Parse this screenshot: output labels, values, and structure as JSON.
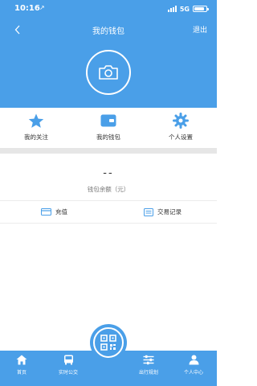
{
  "status_bar": {
    "time": "10:16",
    "location_glyph": "↗",
    "network": "5G",
    "battery_level": 0.85
  },
  "nav": {
    "back_icon": "chevron-left-icon",
    "title": "我的钱包",
    "logout": "退出"
  },
  "profile": {
    "avatar_icon": "camera-icon"
  },
  "menu": {
    "items": [
      {
        "label": "我的关注",
        "icon": "star-icon"
      },
      {
        "label": "我的钱包",
        "icon": "wallet-icon"
      },
      {
        "label": "个人设置",
        "icon": "gear-icon"
      }
    ]
  },
  "wallet": {
    "balance": "--",
    "balance_label": "钱包余额（元）"
  },
  "actions": {
    "recharge": "充值",
    "transactions": "交易记录"
  },
  "tabbar": {
    "items": [
      {
        "label": "首页",
        "icon": "home-icon"
      },
      {
        "label": "实时公交",
        "icon": "bus-icon"
      },
      {
        "label": "出行规划",
        "icon": "sliders-icon"
      },
      {
        "label": "个人中心",
        "icon": "person-icon"
      }
    ],
    "center_icon": "qr-code-icon"
  },
  "colors": {
    "primary": "#4a9fe8",
    "divider": "#e6e6e6",
    "text": "#333333"
  }
}
